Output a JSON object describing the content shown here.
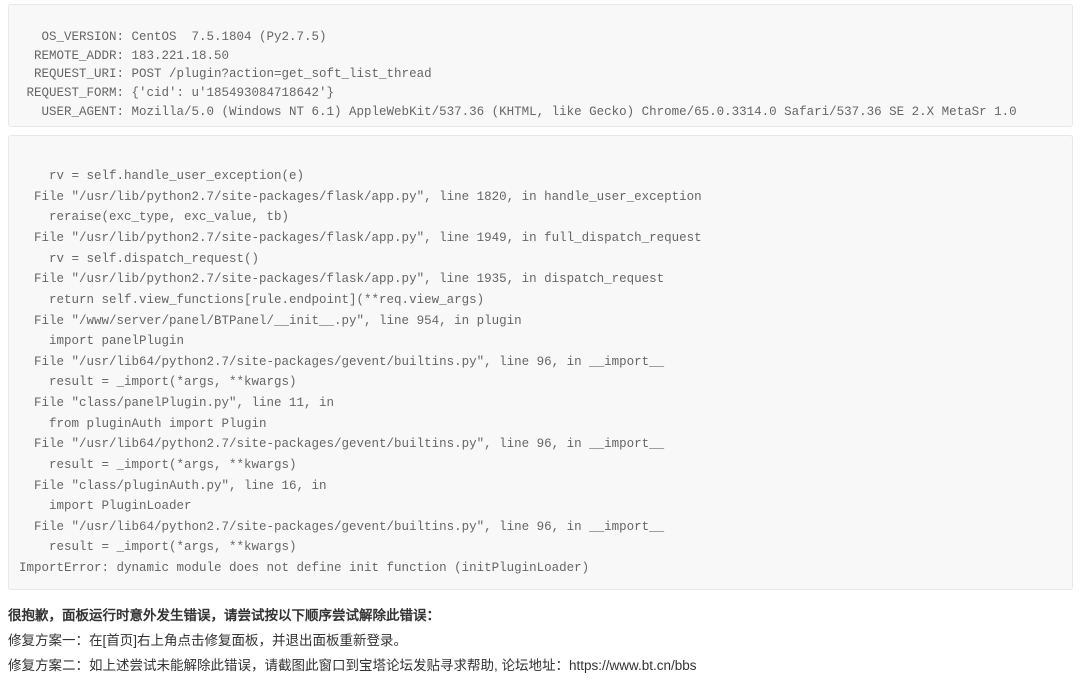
{
  "request_info": {
    "lines": [
      "   OS_VERSION: CentOS  7.5.1804 (Py2.7.5)",
      "  REMOTE_ADDR: 183.221.18.50",
      "  REQUEST_URI: POST /plugin?action=get_soft_list_thread",
      " REQUEST_FORM: {'cid': u'185493084718642'}",
      "   USER_AGENT: Mozilla/5.0 (Windows NT 6.1) AppleWebKit/537.36 (KHTML, like Gecko) Chrome/65.0.3314.0 Safari/537.36 SE 2.X MetaSr 1.0"
    ]
  },
  "traceback": {
    "lines": [
      "    rv = self.handle_user_exception(e)",
      "  File \"/usr/lib/python2.7/site-packages/flask/app.py\", line 1820, in handle_user_exception",
      "    reraise(exc_type, exc_value, tb)",
      "  File \"/usr/lib/python2.7/site-packages/flask/app.py\", line 1949, in full_dispatch_request",
      "    rv = self.dispatch_request()",
      "  File \"/usr/lib/python2.7/site-packages/flask/app.py\", line 1935, in dispatch_request",
      "    return self.view_functions[rule.endpoint](**req.view_args)",
      "  File \"/www/server/panel/BTPanel/__init__.py\", line 954, in plugin",
      "    import panelPlugin",
      "  File \"/usr/lib64/python2.7/site-packages/gevent/builtins.py\", line 96, in __import__",
      "    result = _import(*args, **kwargs)",
      "  File \"class/panelPlugin.py\", line 11, in ",
      "    from pluginAuth import Plugin",
      "  File \"/usr/lib64/python2.7/site-packages/gevent/builtins.py\", line 96, in __import__",
      "    result = _import(*args, **kwargs)",
      "  File \"class/pluginAuth.py\", line 16, in ",
      "    import PluginLoader",
      "  File \"/usr/lib64/python2.7/site-packages/gevent/builtins.py\", line 96, in __import__",
      "    result = _import(*args, **kwargs)",
      "ImportError: dynamic module does not define init function (initPluginLoader)"
    ]
  },
  "message": {
    "title": "很抱歉，面板运行时意外发生错误，请尝试按以下顺序尝试解除此错误：",
    "fix1": "修复方案一：在[首页]右上角点击修复面板，并退出面板重新登录。",
    "fix2": "修复方案二：如上述尝试未能解除此错误，请截图此窗口到宝塔论坛发贴寻求帮助, 论坛地址：https://www.bt.cn/bbs"
  }
}
